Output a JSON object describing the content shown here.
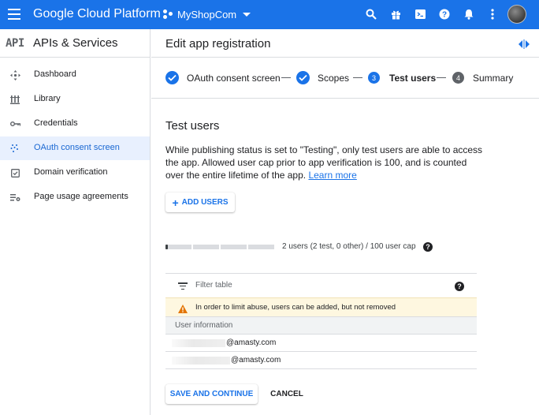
{
  "topbar": {
    "brand": "Google Cloud Platform",
    "project_name": "MyShopCom",
    "icons": [
      "menu-icon",
      "project-icon",
      "search-icon",
      "gift-icon",
      "cloud-shell-icon",
      "help-icon",
      "notifications-icon",
      "more-vert-icon",
      "account-avatar"
    ],
    "background": "#1a73e8"
  },
  "sidebar": {
    "logo": "API",
    "title": "APIs & Services",
    "items": [
      {
        "label": "Dashboard",
        "icon": "dashboard-icon",
        "active": false
      },
      {
        "label": "Library",
        "icon": "library-icon",
        "active": false
      },
      {
        "label": "Credentials",
        "icon": "key-icon",
        "active": false
      },
      {
        "label": "OAuth consent screen",
        "icon": "consent-icon",
        "active": true
      },
      {
        "label": "Domain verification",
        "icon": "domain-check-icon",
        "active": false
      },
      {
        "label": "Page usage agreements",
        "icon": "settings-list-icon",
        "active": false
      }
    ]
  },
  "header": {
    "title": "Edit app registration"
  },
  "stepper": {
    "steps": [
      {
        "number": "1",
        "label": "OAuth consent screen",
        "state": "done"
      },
      {
        "number": "2",
        "label": "Scopes",
        "state": "done"
      },
      {
        "number": "3",
        "label": "Test users",
        "state": "current"
      },
      {
        "number": "4",
        "label": "Summary",
        "state": "upcoming"
      }
    ]
  },
  "content": {
    "title": "Test users",
    "description": "While publishing status is set to \"Testing\", only test users are able to access the app. Allowed user cap prior to app verification is 100, and is counted over the entire lifetime of the app.",
    "learn_more": "Learn more",
    "add_users_label": "ADD USERS",
    "cap": {
      "used": 2,
      "limit": 100,
      "text": "2 users (2 test, 0 other) / 100 user cap"
    }
  },
  "table": {
    "filter_placeholder": "Filter table",
    "warning": "In order to limit abuse, users can be added, but not removed",
    "column_header": "User information",
    "rows": [
      {
        "email_suffix": "@amasty.com"
      },
      {
        "email_suffix": "@amasty.com"
      }
    ]
  },
  "actions": {
    "save_label": "SAVE AND CONTINUE",
    "cancel_label": "CANCEL"
  },
  "colors": {
    "accent": "#1a73e8",
    "active_bg": "#e8f0fe",
    "warning_bg": "#fef7e0",
    "warning_icon": "#e37400"
  }
}
